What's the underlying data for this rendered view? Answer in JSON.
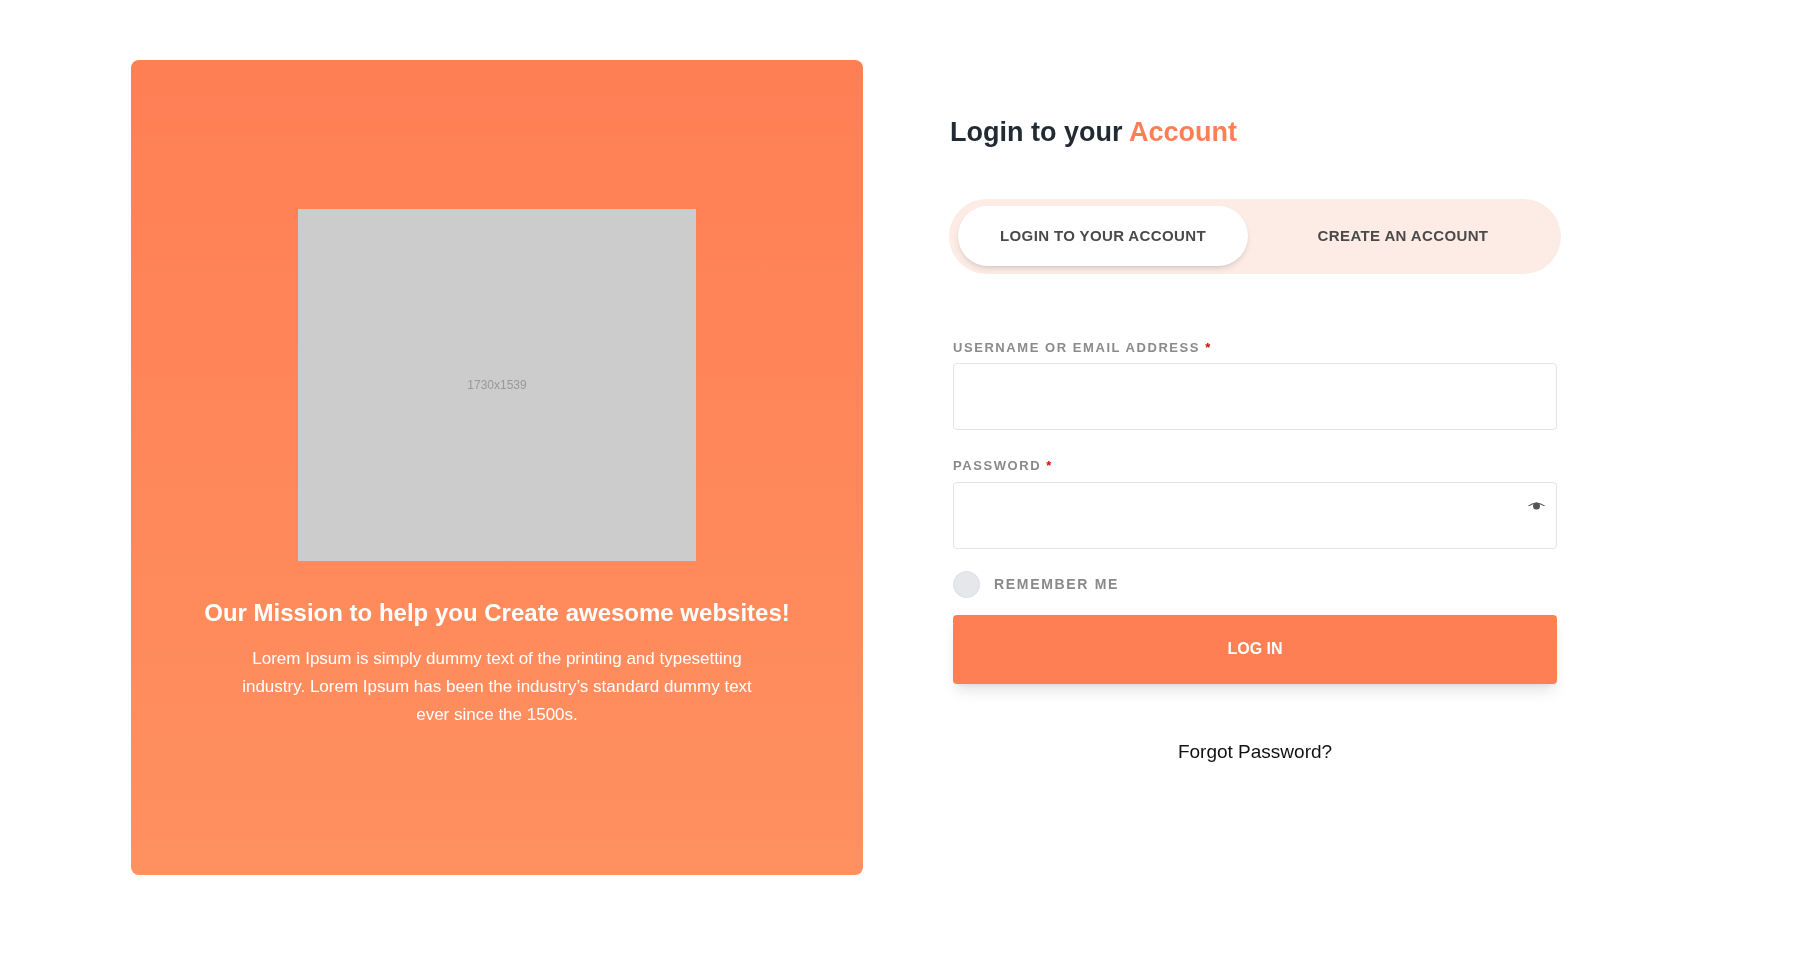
{
  "promo": {
    "image": {
      "label": "1730x1539"
    },
    "title": "Our Mission to help you Create awesome websites!",
    "body": "Lorem Ipsum is simply dummy text of the printing and typesetting industry. Lorem Ipsum has been the industry’s standard dummy text ever since the 1500s."
  },
  "login": {
    "heading": {
      "text": "Login to your",
      "highlight": "Account"
    },
    "tabs": [
      {
        "label": "LOGIN TO YOUR ACCOUNT",
        "selected": true
      },
      {
        "label": "CREATE AN ACCOUNT",
        "selected": false
      }
    ],
    "fields": [
      {
        "kind": "text",
        "label": "USERNAME OR EMAIL ADDRESS",
        "required": "*"
      },
      {
        "kind": "password",
        "label": "PASSWORD",
        "required": "*"
      }
    ],
    "remember": {
      "label": "REMEMBER ME",
      "checked": false
    },
    "submit": "LOG IN",
    "forgot": "Forgot Password?"
  }
}
